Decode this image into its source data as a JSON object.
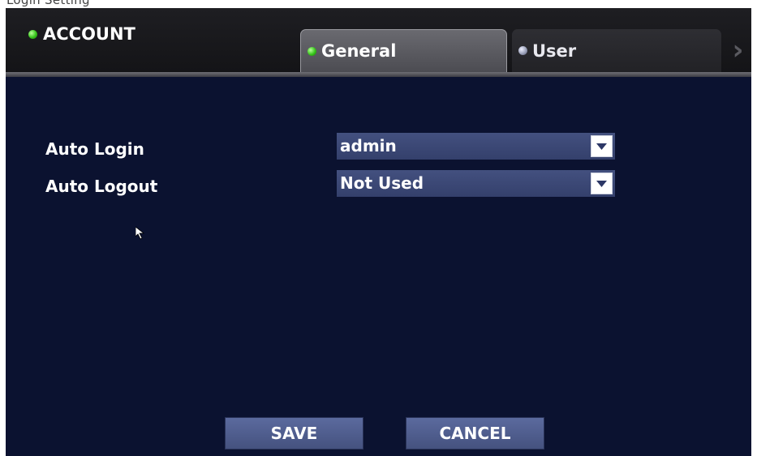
{
  "page_header_fragment": "Login Setting",
  "header": {
    "title": "ACCOUNT",
    "title_led": "green",
    "tabs": [
      {
        "label": "General",
        "active": true,
        "led": "green"
      },
      {
        "label": "User",
        "active": false,
        "led": "grey"
      }
    ],
    "next_icon": "chevron-right-icon"
  },
  "settings": [
    {
      "label": "Auto Login",
      "value": "admin"
    },
    {
      "label": "Auto Logout",
      "value": "Not Used"
    }
  ],
  "buttons": {
    "save": "SAVE",
    "cancel": "CANCEL"
  },
  "colors": {
    "background": "#0b1230",
    "header": "#1e1e22",
    "field": "#3b4775",
    "button": "#51608f",
    "led_green": "#36c41a"
  }
}
